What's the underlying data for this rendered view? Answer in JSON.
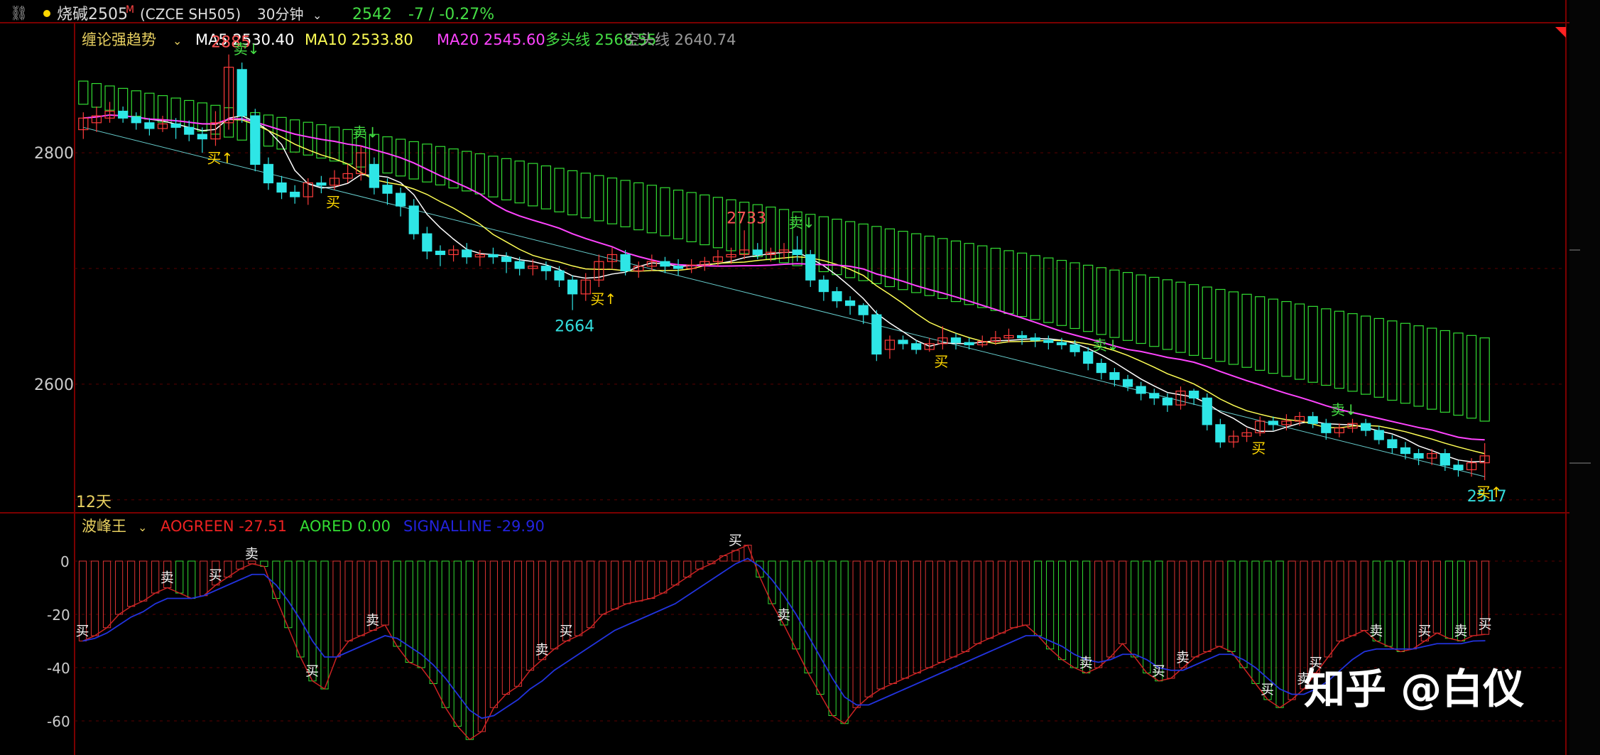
{
  "header": {
    "link_icon": "link-icon",
    "dot_color": "#ffd700",
    "symbol_name": "烧碱2505",
    "symbol_flag": "M",
    "symbol_code": "(CZCE SH505)",
    "period": "30分钟",
    "price": "2542",
    "change": "-7 / -0.27%"
  },
  "main_legend": {
    "indicator": "缠论强趋势",
    "items": [
      {
        "label": "MA5",
        "value": "2530.40",
        "color": "#ffffff"
      },
      {
        "label": "MA10",
        "value": "2533.80",
        "color": "#ffff55"
      },
      {
        "label": "MA20",
        "value": "2545.60",
        "color": "#ff44ff"
      },
      {
        "label": "多头线",
        "value": "2568.55",
        "color": "#44dd44"
      },
      {
        "label": "空头线",
        "value": "2640.74",
        "color": "#999999"
      }
    ]
  },
  "sub_legend": {
    "indicator": "波峰王",
    "items": [
      {
        "label": "AOGREEN",
        "value": "-27.51",
        "color": "#ee2222"
      },
      {
        "label": "AORED",
        "value": "0.00",
        "color": "#33dd33"
      },
      {
        "label": "SIGNALLINE",
        "value": "-29.90",
        "color": "#2222dd"
      }
    ]
  },
  "period_label": "12天",
  "watermark": "知乎 @白仪",
  "colors": {
    "up": "#ff3b3b",
    "down": "#2ee6e6",
    "grid": "#5a0000",
    "axis": "#7a0000",
    "band": "#33dd33"
  },
  "chart_data": [
    {
      "type": "candlestick",
      "ylim": [
        2490,
        2910
      ],
      "yticks": [
        2600,
        2800
      ],
      "annotations": [
        {
          "i": 11,
          "text": "2885",
          "kind": "high"
        },
        {
          "i": 37,
          "text": "2664",
          "kind": "low"
        },
        {
          "i": 50,
          "text": "2733",
          "kind": "high"
        },
        {
          "i": 106,
          "text": "2517",
          "kind": "low"
        }
      ],
      "signals": [
        {
          "i": 12,
          "text": "卖↓",
          "pos": "above"
        },
        {
          "i": 10,
          "text": "买↑",
          "pos": "below"
        },
        {
          "i": 21,
          "text": "卖↓",
          "pos": "above"
        },
        {
          "i": 19,
          "text": "买",
          "pos": "below"
        },
        {
          "i": 39,
          "text": "买↑",
          "pos": "below"
        },
        {
          "i": 54,
          "text": "卖↓",
          "pos": "above"
        },
        {
          "i": 65,
          "text": "买",
          "pos": "below"
        },
        {
          "i": 77,
          "text": "卖↓",
          "pos": "above"
        },
        {
          "i": 89,
          "text": "买",
          "pos": "below"
        },
        {
          "i": 95,
          "text": "卖↓",
          "pos": "above"
        },
        {
          "i": 106,
          "text": "买↑",
          "pos": "below"
        }
      ],
      "candles": [
        [
          2820,
          2830,
          2812,
          2835
        ],
        [
          2826,
          2832,
          2818,
          2840
        ],
        [
          2830,
          2836,
          2826,
          2844
        ],
        [
          2836,
          2830,
          2826,
          2840
        ],
        [
          2831,
          2826,
          2820,
          2835
        ],
        [
          2826,
          2821,
          2815,
          2830
        ],
        [
          2821,
          2825,
          2818,
          2832
        ],
        [
          2825,
          2822,
          2812,
          2830
        ],
        [
          2822,
          2816,
          2810,
          2828
        ],
        [
          2816,
          2812,
          2800,
          2822
        ],
        [
          2812,
          2826,
          2806,
          2836
        ],
        [
          2826,
          2874,
          2820,
          2885
        ],
        [
          2872,
          2832,
          2826,
          2878
        ],
        [
          2832,
          2790,
          2784,
          2838
        ],
        [
          2790,
          2774,
          2768,
          2796
        ],
        [
          2774,
          2766,
          2760,
          2780
        ],
        [
          2766,
          2762,
          2756,
          2772
        ],
        [
          2762,
          2774,
          2755,
          2778
        ],
        [
          2774,
          2772,
          2765,
          2780
        ],
        [
          2772,
          2778,
          2768,
          2785
        ],
        [
          2778,
          2782,
          2774,
          2790
        ],
        [
          2782,
          2800,
          2776,
          2806
        ],
        [
          2790,
          2770,
          2764,
          2796
        ],
        [
          2772,
          2765,
          2755,
          2778
        ],
        [
          2765,
          2754,
          2745,
          2770
        ],
        [
          2754,
          2730,
          2725,
          2760
        ],
        [
          2730,
          2715,
          2708,
          2736
        ],
        [
          2715,
          2712,
          2702,
          2720
        ],
        [
          2712,
          2716,
          2706,
          2720
        ],
        [
          2716,
          2710,
          2704,
          2722
        ],
        [
          2710,
          2712,
          2702,
          2716
        ],
        [
          2712,
          2710,
          2704,
          2718
        ],
        [
          2710,
          2706,
          2696,
          2714
        ],
        [
          2706,
          2700,
          2694,
          2710
        ],
        [
          2700,
          2702,
          2694,
          2708
        ],
        [
          2702,
          2698,
          2690,
          2706
        ],
        [
          2698,
          2690,
          2684,
          2702
        ],
        [
          2690,
          2678,
          2664,
          2694
        ],
        [
          2678,
          2690,
          2672,
          2696
        ],
        [
          2690,
          2706,
          2684,
          2712
        ],
        [
          2706,
          2712,
          2700,
          2718
        ],
        [
          2712,
          2698,
          2694,
          2716
        ],
        [
          2698,
          2702,
          2692,
          2706
        ],
        [
          2702,
          2706,
          2698,
          2712
        ],
        [
          2706,
          2702,
          2696,
          2710
        ],
        [
          2702,
          2700,
          2694,
          2708
        ],
        [
          2700,
          2703,
          2696,
          2708
        ],
        [
          2703,
          2706,
          2698,
          2710
        ],
        [
          2706,
          2710,
          2702,
          2716
        ],
        [
          2710,
          2712,
          2704,
          2718
        ],
        [
          2712,
          2716,
          2708,
          2733
        ],
        [
          2716,
          2712,
          2708,
          2722
        ],
        [
          2712,
          2714,
          2706,
          2718
        ],
        [
          2714,
          2716,
          2708,
          2722
        ],
        [
          2716,
          2712,
          2706,
          2728
        ],
        [
          2712,
          2690,
          2684,
          2716
        ],
        [
          2690,
          2680,
          2672,
          2694
        ],
        [
          2680,
          2672,
          2666,
          2684
        ],
        [
          2672,
          2668,
          2660,
          2676
        ],
        [
          2668,
          2660,
          2652,
          2670
        ],
        [
          2660,
          2626,
          2620,
          2664
        ],
        [
          2630,
          2638,
          2622,
          2642
        ],
        [
          2638,
          2635,
          2630,
          2642
        ],
        [
          2635,
          2630,
          2626,
          2638
        ],
        [
          2630,
          2635,
          2628,
          2640
        ],
        [
          2635,
          2640,
          2630,
          2650
        ],
        [
          2640,
          2636,
          2630,
          2644
        ],
        [
          2636,
          2634,
          2630,
          2640
        ],
        [
          2634,
          2637,
          2632,
          2642
        ],
        [
          2637,
          2640,
          2634,
          2646
        ],
        [
          2640,
          2642,
          2636,
          2648
        ],
        [
          2642,
          2640,
          2634,
          2646
        ],
        [
          2640,
          2638,
          2632,
          2644
        ],
        [
          2638,
          2636,
          2630,
          2642
        ],
        [
          2636,
          2634,
          2630,
          2640
        ],
        [
          2634,
          2628,
          2624,
          2638
        ],
        [
          2628,
          2618,
          2612,
          2632
        ],
        [
          2618,
          2610,
          2604,
          2622
        ],
        [
          2610,
          2604,
          2598,
          2614
        ],
        [
          2604,
          2598,
          2594,
          2608
        ],
        [
          2598,
          2592,
          2586,
          2602
        ],
        [
          2592,
          2588,
          2582,
          2596
        ],
        [
          2588,
          2582,
          2576,
          2592
        ],
        [
          2582,
          2594,
          2578,
          2598
        ],
        [
          2594,
          2588,
          2582,
          2596
        ],
        [
          2588,
          2565,
          2560,
          2592
        ],
        [
          2565,
          2550,
          2545,
          2570
        ],
        [
          2550,
          2555,
          2545,
          2560
        ],
        [
          2555,
          2558,
          2550,
          2562
        ],
        [
          2558,
          2568,
          2555,
          2572
        ],
        [
          2568,
          2565,
          2560,
          2572
        ],
        [
          2565,
          2568,
          2560,
          2574
        ],
        [
          2568,
          2572,
          2564,
          2576
        ],
        [
          2572,
          2566,
          2562,
          2576
        ],
        [
          2566,
          2558,
          2552,
          2570
        ],
        [
          2558,
          2562,
          2554,
          2566
        ],
        [
          2562,
          2566,
          2558,
          2570
        ],
        [
          2566,
          2560,
          2555,
          2570
        ],
        [
          2560,
          2552,
          2548,
          2564
        ],
        [
          2552,
          2545,
          2540,
          2556
        ],
        [
          2545,
          2540,
          2535,
          2550
        ],
        [
          2540,
          2536,
          2530,
          2544
        ],
        [
          2536,
          2540,
          2530,
          2544
        ],
        [
          2540,
          2530,
          2525,
          2544
        ],
        [
          2530,
          2526,
          2520,
          2534
        ],
        [
          2526,
          2532,
          2520,
          2536
        ],
        [
          2532,
          2538,
          2517,
          2549
        ]
      ],
      "band": {
        "top_start": 2862,
        "top_end": 2640,
        "bottom_start": 2842,
        "bottom_end": 2568
      },
      "trend_line": {
        "start": 2822,
        "end": 2520
      }
    },
    {
      "type": "bar",
      "ylim": [
        -72,
        8
      ],
      "yticks": [
        0,
        -20,
        -40,
        -60
      ],
      "labels": [
        {
          "i": 0,
          "text": "买"
        },
        {
          "i": 7,
          "text": "卖"
        },
        {
          "i": 11,
          "text": "买"
        },
        {
          "i": 14,
          "text": "卖"
        },
        {
          "i": 19,
          "text": "买"
        },
        {
          "i": 24,
          "text": "卖"
        },
        {
          "i": 38,
          "text": "卖"
        },
        {
          "i": 40,
          "text": "买"
        },
        {
          "i": 54,
          "text": "买"
        },
        {
          "i": 58,
          "text": "卖"
        },
        {
          "i": 83,
          "text": "卖"
        },
        {
          "i": 89,
          "text": "买"
        },
        {
          "i": 91,
          "text": "卖"
        },
        {
          "i": 98,
          "text": "买"
        },
        {
          "i": 101,
          "text": "卖"
        },
        {
          "i": 102,
          "text": "买"
        },
        {
          "i": 107,
          "text": "卖"
        },
        {
          "i": 111,
          "text": "买"
        },
        {
          "i": 114,
          "text": "卖"
        },
        {
          "i": 116,
          "text": "买"
        }
      ],
      "ao": [
        -30,
        -28,
        -25,
        -20,
        -17,
        -15,
        -12,
        -10,
        -12,
        -14,
        -13,
        -9,
        -6,
        -3,
        -1,
        -2,
        -14,
        -25,
        -36,
        -45,
        -48,
        -36,
        -30,
        -28,
        -26,
        -24,
        -32,
        -38,
        -40,
        -46,
        -55,
        -62,
        -67,
        -64,
        -55,
        -50,
        -47,
        -41,
        -37,
        -33,
        -30,
        -28,
        -25,
        -20,
        -18,
        -16,
        -15,
        -14,
        -12,
        -9,
        -6,
        -3,
        -1,
        2,
        4,
        6,
        -6,
        -16,
        -24,
        -33,
        -42,
        -50,
        -58,
        -61,
        -55,
        -51,
        -48,
        -46,
        -44,
        -42,
        -40,
        -38,
        -36,
        -34,
        -31,
        -29,
        -27,
        -25,
        -24,
        -28,
        -33,
        -37,
        -40,
        -42,
        -40,
        -36,
        -31,
        -36,
        -42,
        -45,
        -44,
        -40,
        -36,
        -34,
        -32,
        -34,
        -40,
        -46,
        -52,
        -55,
        -52,
        -48,
        -42,
        -36,
        -30,
        -28,
        -26,
        -30,
        -32,
        -34,
        -33,
        -30,
        -27,
        -29,
        -30,
        -28,
        -27.51
      ],
      "signal": [
        -30,
        -29,
        -27,
        -24,
        -21,
        -19,
        -16,
        -14,
        -14,
        -14,
        -13,
        -11,
        -9,
        -7,
        -5,
        -5,
        -9,
        -15,
        -22,
        -30,
        -36,
        -36,
        -34,
        -32,
        -30,
        -28,
        -29,
        -32,
        -35,
        -39,
        -44,
        -50,
        -56,
        -59,
        -58,
        -55,
        -52,
        -48,
        -45,
        -41,
        -38,
        -35,
        -32,
        -29,
        -26,
        -24,
        -22,
        -20,
        -18,
        -16,
        -13,
        -10,
        -7,
        -4,
        -1,
        1,
        -2,
        -7,
        -13,
        -20,
        -28,
        -36,
        -44,
        -51,
        -54,
        -54,
        -52,
        -50,
        -48,
        -46,
        -44,
        -42,
        -40,
        -38,
        -36,
        -34,
        -32,
        -30,
        -28,
        -28,
        -30,
        -32,
        -35,
        -37,
        -38,
        -37,
        -35,
        -35,
        -37,
        -40,
        -41,
        -41,
        -39,
        -37,
        -35,
        -35,
        -37,
        -40,
        -44,
        -48,
        -50,
        -50,
        -48,
        -45,
        -41,
        -37,
        -34,
        -33,
        -33,
        -33,
        -33,
        -32,
        -31,
        -31,
        -31,
        -30,
        -29.9
      ]
    }
  ]
}
